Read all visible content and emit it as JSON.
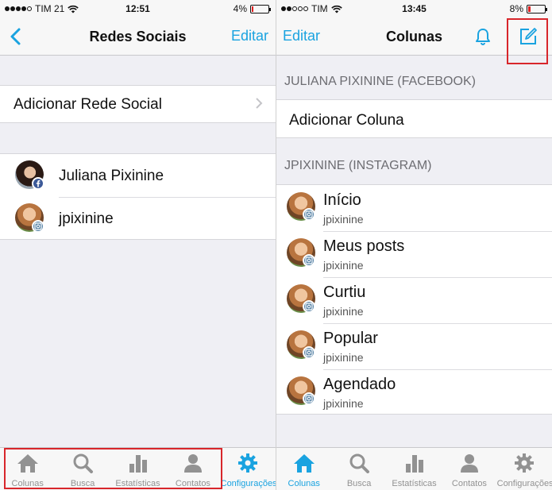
{
  "left": {
    "status": {
      "carrier": "TIM 21",
      "time": "12:51",
      "battery": "4%"
    },
    "nav": {
      "title": "Redes Sociais",
      "right_button": "Editar"
    },
    "add_row": {
      "label": "Adicionar Rede Social"
    },
    "accounts": [
      {
        "name": "Juliana Pixinine",
        "network": "facebook"
      },
      {
        "name": "jpixinine",
        "network": "instagram"
      }
    ],
    "tabs": [
      {
        "label": "Colunas",
        "icon": "home-icon",
        "active": false
      },
      {
        "label": "Busca",
        "icon": "search-icon",
        "active": false
      },
      {
        "label": "Estatísticas",
        "icon": "bar-chart-icon",
        "active": false
      },
      {
        "label": "Contatos",
        "icon": "person-icon",
        "active": false
      },
      {
        "label": "Configurações",
        "icon": "gear-icon",
        "active": true
      }
    ]
  },
  "right": {
    "status": {
      "carrier": "TIM",
      "time": "13:45",
      "battery": "8%"
    },
    "nav": {
      "title": "Colunas",
      "left_button": "Editar"
    },
    "sections": {
      "facebook_header": "JULIANA PIXININE (FACEBOOK)",
      "facebook_add": "Adicionar Coluna",
      "instagram_header": "JPIXININE (INSTAGRAM)"
    },
    "columns": [
      {
        "title": "Início",
        "subtitle": "jpixinine"
      },
      {
        "title": "Meus posts",
        "subtitle": "jpixinine"
      },
      {
        "title": "Curtiu",
        "subtitle": "jpixinine"
      },
      {
        "title": "Popular",
        "subtitle": "jpixinine"
      },
      {
        "title": "Agendado",
        "subtitle": "jpixinine"
      }
    ],
    "tabs": [
      {
        "label": "Colunas",
        "icon": "home-icon",
        "active": true
      },
      {
        "label": "Busca",
        "icon": "search-icon",
        "active": false
      },
      {
        "label": "Estatísticas",
        "icon": "bar-chart-icon",
        "active": false
      },
      {
        "label": "Contatos",
        "icon": "person-icon",
        "active": false
      },
      {
        "label": "Configurações",
        "icon": "gear-icon",
        "active": false
      }
    ]
  },
  "colors": {
    "accent": "#1aa3e0",
    "highlight": "#d8262b",
    "inactive": "#929292"
  }
}
